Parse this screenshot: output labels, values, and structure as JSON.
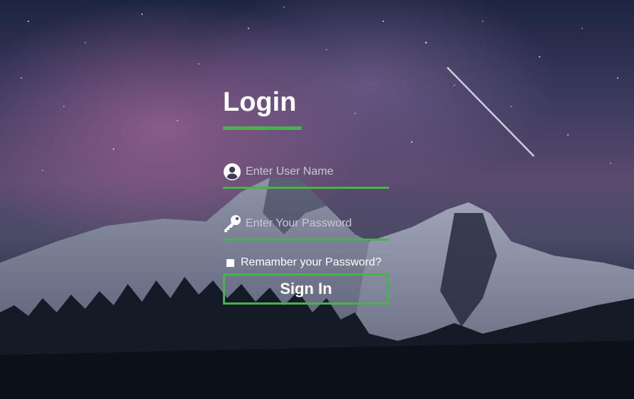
{
  "login": {
    "title": "Login",
    "username": {
      "placeholder": "Enter User Name",
      "value": "",
      "icon": "user-circle-icon"
    },
    "password": {
      "placeholder": "Enter Your Password",
      "value": "",
      "icon": "key-icon"
    },
    "remember_label": "Remamber your Password?",
    "remember_checked": false,
    "submit_label": "Sign In"
  },
  "colors": {
    "accent": "#4caf50",
    "text": "#ffffff"
  }
}
